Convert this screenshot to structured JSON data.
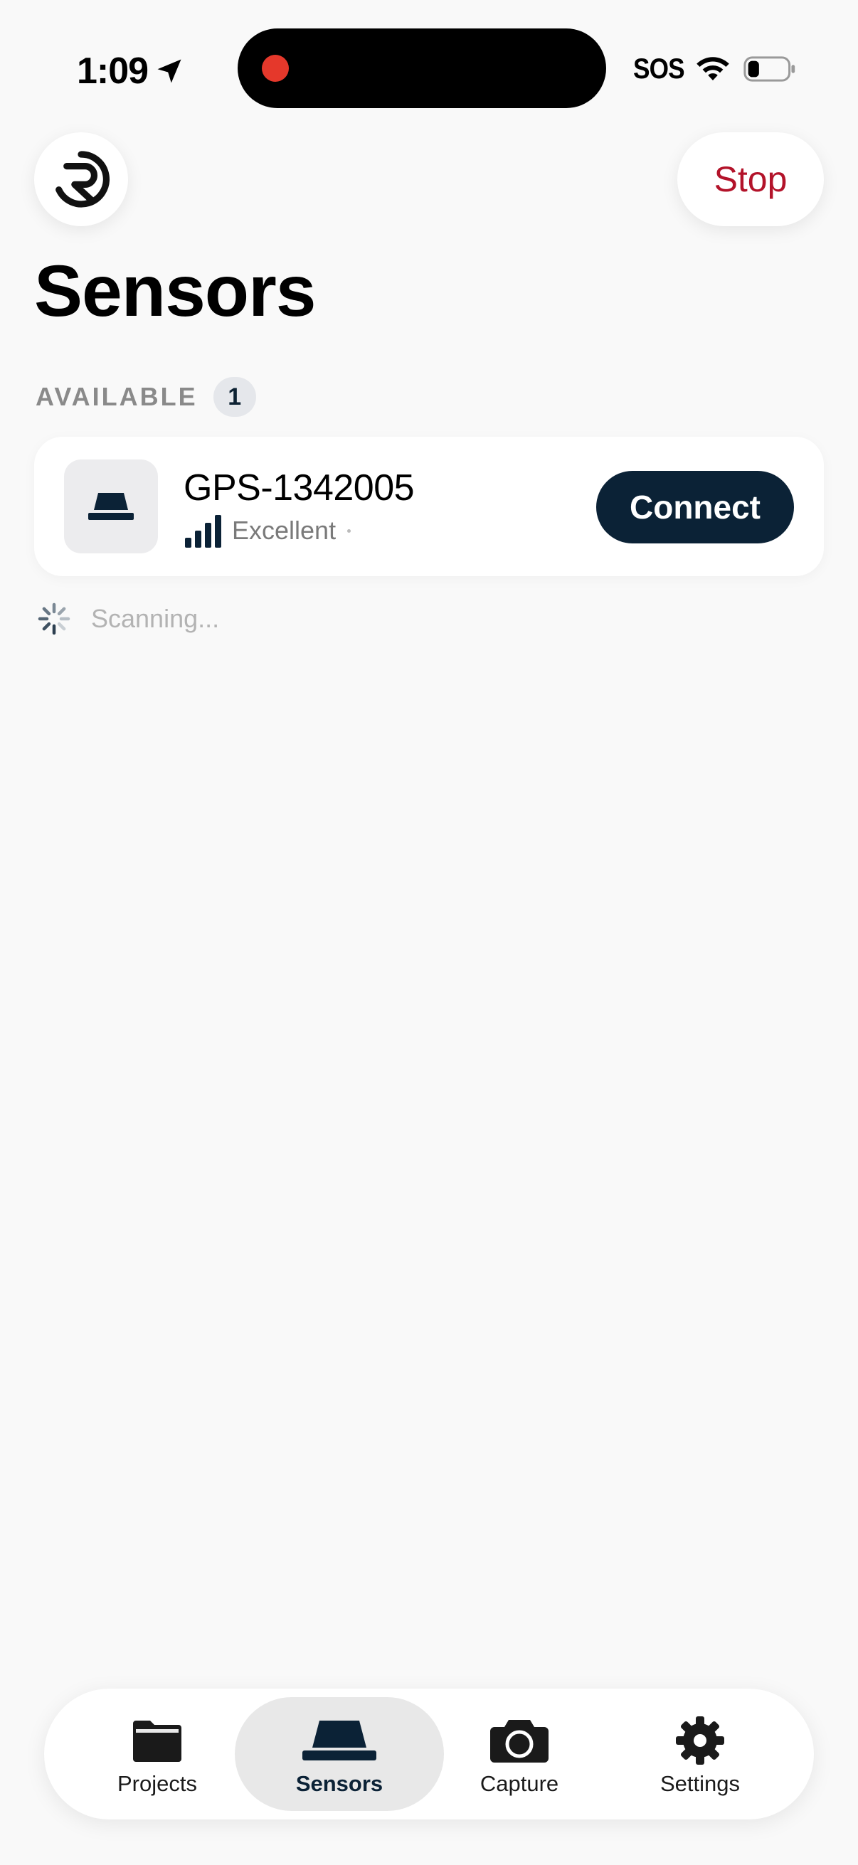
{
  "status_bar": {
    "time": "1:09",
    "carrier": "SOS",
    "location_icon": "location-arrow-icon",
    "wifi_icon": "wifi-icon",
    "battery_icon": "battery-low-icon",
    "recording_dot_color": "#e5382b"
  },
  "header": {
    "logo_icon": "app-logo-icon",
    "stop_label": "Stop",
    "stop_color": "#b3132a",
    "title": "Sensors"
  },
  "available_section": {
    "label": "AVAILABLE",
    "count": "1"
  },
  "devices": [
    {
      "icon": "gps-receiver-icon",
      "name": "GPS-1342005",
      "signal_icon": "signal-bars-icon",
      "signal_label": "Excellent",
      "action_label": "Connect",
      "action_color": "#0b2236"
    }
  ],
  "scanning": {
    "icon": "spinner-icon",
    "text": "Scanning..."
  },
  "tab_bar": {
    "active": "Sensors",
    "tabs": [
      {
        "label": "Projects",
        "icon": "folder-icon"
      },
      {
        "label": "Sensors",
        "icon": "gps-receiver-icon"
      },
      {
        "label": "Capture",
        "icon": "camera-icon"
      },
      {
        "label": "Settings",
        "icon": "gear-icon"
      }
    ]
  }
}
